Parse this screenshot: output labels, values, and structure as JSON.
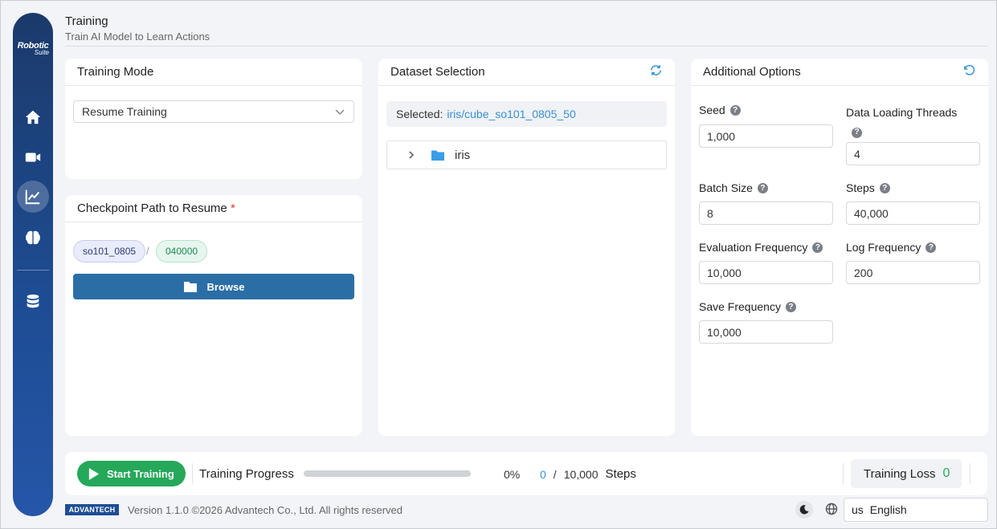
{
  "app": {
    "logo_line1": "Robotic",
    "logo_line2": "Suite"
  },
  "header": {
    "title": "Training",
    "subtitle": "Train AI Model to Learn Actions"
  },
  "nav": {
    "items": [
      {
        "name": "home",
        "icon": "home-icon",
        "active": false
      },
      {
        "name": "video",
        "icon": "video-camera-icon",
        "active": false
      },
      {
        "name": "training",
        "icon": "line-chart-icon",
        "active": true
      },
      {
        "name": "model",
        "icon": "brain-icon",
        "active": false
      },
      {
        "name": "data",
        "icon": "database-icon",
        "active": false
      }
    ]
  },
  "training_mode": {
    "title": "Training Mode",
    "selected": "Resume Training"
  },
  "checkpoint": {
    "title": "Checkpoint Path to Resume",
    "required_mark": "*",
    "chip_run": "so101_0805",
    "separator": "/",
    "chip_step": "040000",
    "browse_label": "Browse"
  },
  "dataset": {
    "title": "Dataset Selection",
    "selected_label": "Selected:",
    "selected_value": "iris/cube_so101_0805_50",
    "tree": [
      {
        "label": "iris"
      }
    ]
  },
  "options": {
    "title": "Additional Options",
    "fields": {
      "seed": {
        "label": "Seed",
        "value": "1,000"
      },
      "threads": {
        "label": "Data Loading Threads",
        "value": "4"
      },
      "batch": {
        "label": "Batch Size",
        "value": "8"
      },
      "steps": {
        "label": "Steps",
        "value": "40,000"
      },
      "eval_freq": {
        "label": "Evaluation Frequency",
        "value": "10,000"
      },
      "log_freq": {
        "label": "Log Frequency",
        "value": "200"
      },
      "save_freq": {
        "label": "Save Frequency",
        "value": "10,000"
      }
    },
    "help_glyph": "?"
  },
  "progress": {
    "start_label": "Start Training",
    "label": "Training Progress",
    "fraction": 0,
    "percent_text": "0%",
    "current_step": "0",
    "separator": "/",
    "total_steps": "10,000",
    "steps_label": "Steps",
    "loss_label": "Training Loss",
    "loss_value": "0"
  },
  "footer": {
    "brand": "ADVANTECH",
    "version_text": "Version 1.1.0 ©2026 Advantech Co., Ltd. All rights reserved",
    "lang_code": "us",
    "lang_name": "English"
  },
  "colors": {
    "accent_blue": "#2b6ea6",
    "link_blue": "#3a8fd6",
    "success_green": "#25a85a",
    "sidebar_navy": "#1e4d95"
  }
}
